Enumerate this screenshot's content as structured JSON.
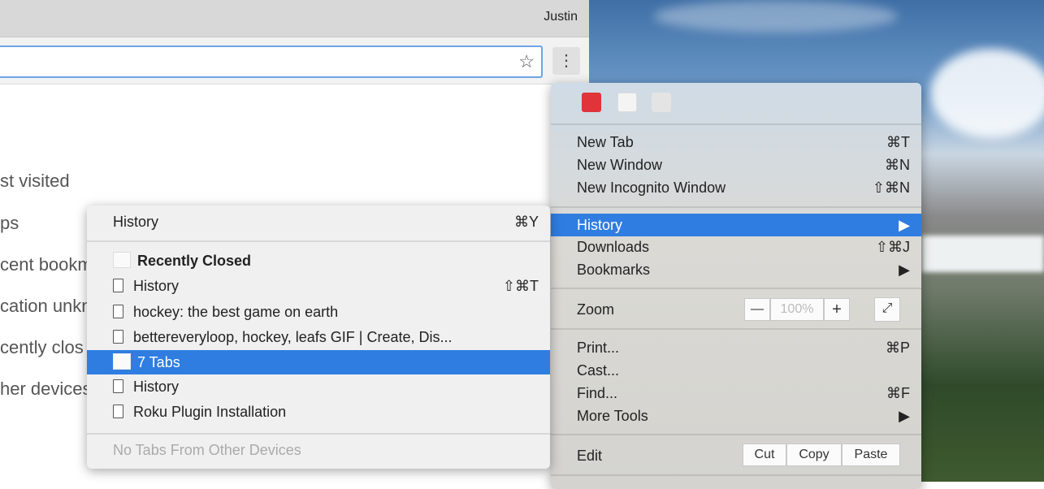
{
  "browser": {
    "user": "Justin"
  },
  "ntp": {
    "items": [
      "st visited",
      "ps",
      "cent bookm",
      "cation unkn",
      "cently clos",
      "her devices"
    ]
  },
  "main_menu": {
    "items_group1": [
      {
        "label": "New Tab",
        "shortcut": "⌘T"
      },
      {
        "label": "New Window",
        "shortcut": "⌘N"
      },
      {
        "label": "New Incognito Window",
        "shortcut": "⇧⌘N"
      }
    ],
    "history": {
      "label": "History",
      "arrow": "▶"
    },
    "downloads": {
      "label": "Downloads",
      "shortcut": "⇧⌘J"
    },
    "bookmarks": {
      "label": "Bookmarks",
      "arrow": "▶"
    },
    "zoom": {
      "label": "Zoom",
      "minus": "—",
      "value": "100%",
      "plus": "+",
      "fullscreen": "⤢"
    },
    "items_group3": [
      {
        "label": "Print...",
        "shortcut": "⌘P"
      },
      {
        "label": "Cast...",
        "shortcut": ""
      },
      {
        "label": "Find...",
        "shortcut": "⌘F"
      },
      {
        "label": "More Tools",
        "shortcut": "▶"
      }
    ],
    "edit": {
      "label": "Edit",
      "cut": "Cut",
      "copy": "Copy",
      "paste": "Paste"
    }
  },
  "history_menu": {
    "header": {
      "label": "History",
      "shortcut": "⌘Y"
    },
    "recently_closed": "Recently Closed",
    "items": [
      {
        "label": "History",
        "shortcut": "⇧⌘T",
        "icon": "page"
      },
      {
        "label": "hockey: the best game on earth",
        "icon": "page"
      },
      {
        "label": "bettereveryloop, hockey, leafs GIF | Create, Dis...",
        "icon": "page"
      },
      {
        "label": "7 Tabs",
        "icon": "folder",
        "selected": true
      },
      {
        "label": "History",
        "icon": "page"
      },
      {
        "label": "Roku Plugin Installation",
        "icon": "page"
      }
    ],
    "footer": "No Tabs From Other Devices"
  },
  "colors": {
    "highlight": "#2f7de1",
    "ext_red": "#e0333a"
  }
}
